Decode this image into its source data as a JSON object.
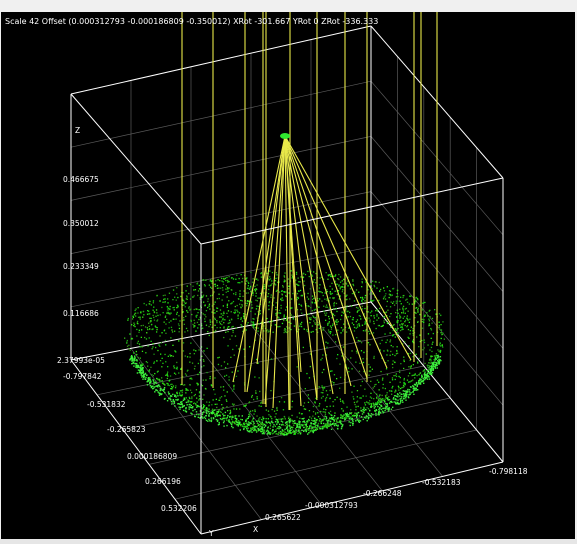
{
  "viewport": {
    "status_text": "Scale 42 Offset (0.000312793 -0.000186809 -0.350012) XRot -301.667 YRot 0 ZRot -336.333"
  },
  "axes": {
    "z_label": "Z",
    "x_label": "X",
    "y_label": "Y",
    "z_ticks": [
      "0.466675",
      "0.350012",
      "0.233349",
      "0.116686",
      "2.37993e-05"
    ],
    "y_ticks_left": [
      "-0.797842",
      "-0.531832",
      "-0.265823",
      "0.000186809",
      "0.266196",
      "0.532206"
    ],
    "x_ticks_bottom": [
      "0.265622",
      "-0.000312793",
      "-0.266248",
      "-0.532183",
      "-0.798118"
    ]
  },
  "colors": {
    "background": "#000000",
    "box": "#ffffff",
    "grid": "#5a5a5a",
    "points": "#2ee82e",
    "rays": "#e8e84a",
    "text": "#ffffff"
  }
}
